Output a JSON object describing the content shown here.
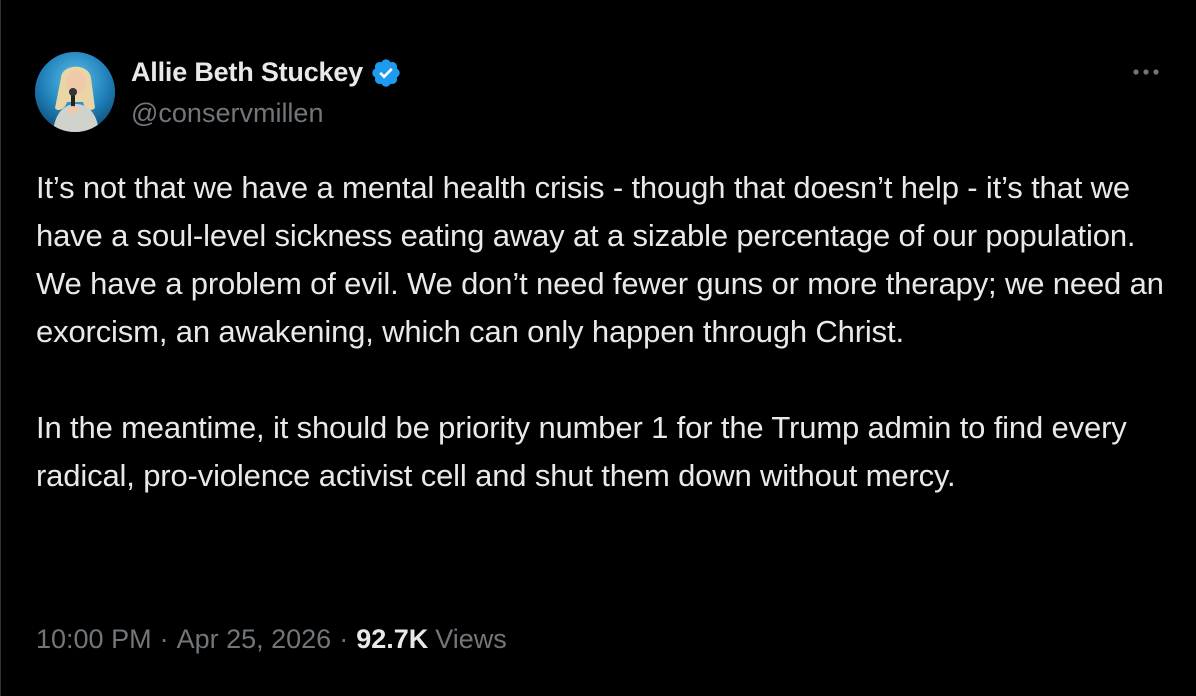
{
  "author": {
    "display_name": "Allie Beth Stuckey",
    "handle": "@conservmillen",
    "verified": true,
    "avatar_icon": "profile-photo"
  },
  "menu": {
    "icon": "more-options-icon"
  },
  "tweet": {
    "paragraphs": [
      "It’s not that we have a mental health crisis - though that doesn’t help - it’s that we have a soul-level sickness eating away at a sizable percentage of our population. We have a problem of evil. We don’t need fewer guns or more therapy; we need an exorcism, an awakening, which can only happen through Christ.",
      "In the meantime, it should be priority number 1 for the Trump admin to find every radical, pro-violence activist cell and shut them down without mercy."
    ],
    "time": "10:00 PM",
    "date": "Apr 25, 2026",
    "views_count": "92.7K",
    "views_label": "Views",
    "separator": "·"
  },
  "colors": {
    "background": "#000000",
    "text_primary": "#e7e9ea",
    "text_secondary": "#71767b",
    "verified_badge": "#1d9bf0"
  }
}
